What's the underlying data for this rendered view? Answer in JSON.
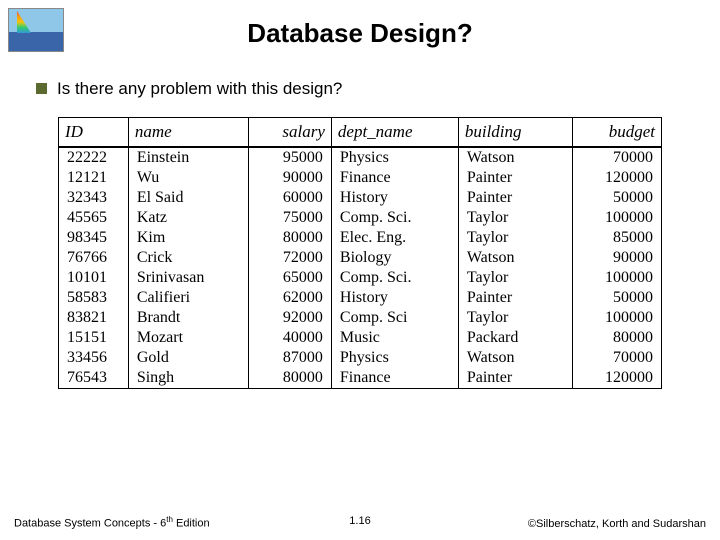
{
  "title": "Database Design?",
  "bullet_text": "Is there any problem with this design?",
  "chart_data": {
    "type": "table",
    "columns": [
      "ID",
      "name",
      "salary",
      "dept_name",
      "building",
      "budget"
    ],
    "rows": [
      [
        "22222",
        "Einstein",
        "95000",
        "Physics",
        "Watson",
        "70000"
      ],
      [
        "12121",
        "Wu",
        "90000",
        "Finance",
        "Painter",
        "120000"
      ],
      [
        "32343",
        "El Said",
        "60000",
        "History",
        "Painter",
        "50000"
      ],
      [
        "45565",
        "Katz",
        "75000",
        "Comp. Sci.",
        "Taylor",
        "100000"
      ],
      [
        "98345",
        "Kim",
        "80000",
        "Elec. Eng.",
        "Taylor",
        "85000"
      ],
      [
        "76766",
        "Crick",
        "72000",
        "Biology",
        "Watson",
        "90000"
      ],
      [
        "10101",
        "Srinivasan",
        "65000",
        "Comp. Sci.",
        "Taylor",
        "100000"
      ],
      [
        "58583",
        "Califieri",
        "62000",
        "History",
        "Painter",
        "50000"
      ],
      [
        "83821",
        "Brandt",
        "92000",
        "Comp. Sci",
        "Taylor",
        "100000"
      ],
      [
        "15151",
        "Mozart",
        "40000",
        "Music",
        "Packard",
        "80000"
      ],
      [
        "33456",
        "Gold",
        "87000",
        "Physics",
        "Watson",
        "70000"
      ],
      [
        "76543",
        "Singh",
        "80000",
        "Finance",
        "Painter",
        "120000"
      ]
    ]
  },
  "footer": {
    "left_prefix": "Database System Concepts - 6",
    "left_sup": "th",
    "left_suffix": " Edition",
    "center": "1.16",
    "right": "©Silberschatz, Korth and Sudarshan"
  }
}
